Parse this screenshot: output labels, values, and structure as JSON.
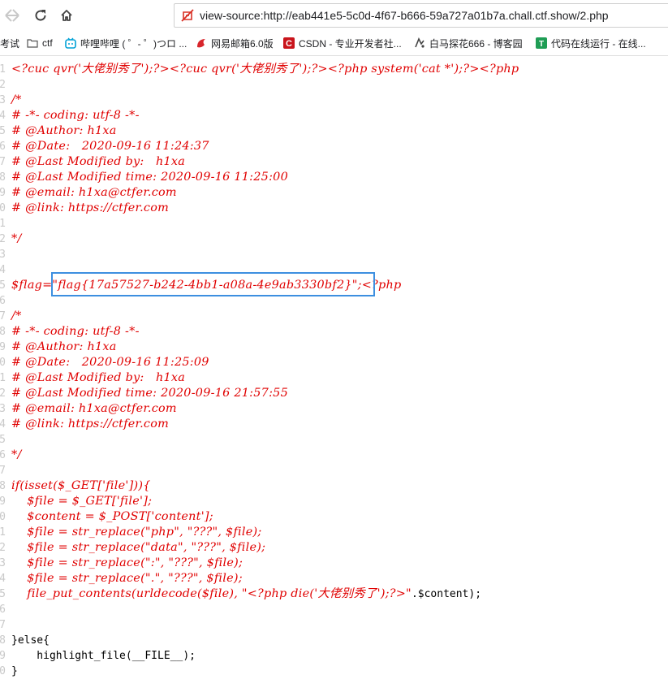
{
  "browser": {
    "url": "view-source:http://eab441e5-5c0d-4f67-b666-59a727a01b7a.chall.ctf.show/2.php",
    "bookmarks": [
      {
        "label": "考试",
        "icon": "none"
      },
      {
        "label": "ctf",
        "icon": "folder-icon"
      },
      {
        "label": "哔哩哔哩 ( ゜- ゜)つロ ...",
        "icon": "bilibili-icon"
      },
      {
        "label": "网易邮箱6.0版",
        "icon": "netease-mail-icon"
      },
      {
        "label": "CSDN - 专业开发者社...",
        "icon": "csdn-icon"
      },
      {
        "label": "白马探花666 - 博客园",
        "icon": "cnblogs-icon"
      },
      {
        "label": "代码在线运行 - 在线...",
        "icon": "runcode-icon"
      }
    ]
  },
  "source": {
    "lines": [
      {
        "n": "1",
        "text": "<?cuc qvr('大佬别秀了');?><?cuc qvr('大佬别秀了');?><?php system('cat *');?><?php"
      },
      {
        "n": "2",
        "text": ""
      },
      {
        "n": "3",
        "text": "/*"
      },
      {
        "n": "4",
        "text": "# -*- coding: utf-8 -*-"
      },
      {
        "n": "5",
        "text": "# @Author: h1xa"
      },
      {
        "n": "6",
        "text": "# @Date:   2020-09-16 11:24:37"
      },
      {
        "n": "7",
        "text": "# @Last Modified by:   h1xa"
      },
      {
        "n": "8",
        "text": "# @Last Modified time: 2020-09-16 11:25:00"
      },
      {
        "n": "9",
        "text": "# @email: h1xa@ctfer.com"
      },
      {
        "n": "0",
        "text": "# @link: https://ctfer.com"
      },
      {
        "n": "1",
        "text": ""
      },
      {
        "n": "2",
        "text": "*/"
      },
      {
        "n": "3",
        "text": ""
      },
      {
        "n": "4",
        "text": ""
      },
      {
        "n": "5",
        "text": "$flag=\"flag{17a57527-b242-4bb1-a08a-4e9ab3330bf2}\";<?php"
      },
      {
        "n": "6",
        "text": ""
      },
      {
        "n": "7",
        "text": "/*"
      },
      {
        "n": "8",
        "text": "# -*- coding: utf-8 -*-"
      },
      {
        "n": "9",
        "text": "# @Author: h1xa"
      },
      {
        "n": "0",
        "text": "# @Date:   2020-09-16 11:25:09"
      },
      {
        "n": "1",
        "text": "# @Last Modified by:   h1xa"
      },
      {
        "n": "2",
        "text": "# @Last Modified time: 2020-09-16 21:57:55"
      },
      {
        "n": "3",
        "text": "# @email: h1xa@ctfer.com"
      },
      {
        "n": "4",
        "text": "# @link: https://ctfer.com"
      },
      {
        "n": "5",
        "text": ""
      },
      {
        "n": "6",
        "text": "*/"
      },
      {
        "n": "7",
        "text": ""
      },
      {
        "n": "8",
        "text": "if(isset($_GET['file'])){"
      },
      {
        "n": "9",
        "text": "    $file = $_GET['file'];"
      },
      {
        "n": "0",
        "text": "    $content = $_POST['content'];"
      },
      {
        "n": "1",
        "text": "    $file = str_replace(\"php\", \"???\", $file);"
      },
      {
        "n": "2",
        "text": "    $file = str_replace(\"data\", \"???\", $file);"
      },
      {
        "n": "3",
        "text": "    $file = str_replace(\":\", \"???\", $file);"
      },
      {
        "n": "4",
        "text": "    $file = str_replace(\".\", \"???\", $file);"
      },
      {
        "n": "5",
        "text": "    file_put_contents(urldecode($file), \"<?php die('大佬别秀了');?>\"",
        "tail": ".$content);"
      },
      {
        "n": "6",
        "text": ""
      },
      {
        "n": "7",
        "text": ""
      },
      {
        "n": "8",
        "text": "}else{",
        "plain": true
      },
      {
        "n": "9",
        "text": "    highlight_file(__FILE__);",
        "plain": true
      },
      {
        "n": "0",
        "text": "}",
        "plain": true
      }
    ]
  }
}
